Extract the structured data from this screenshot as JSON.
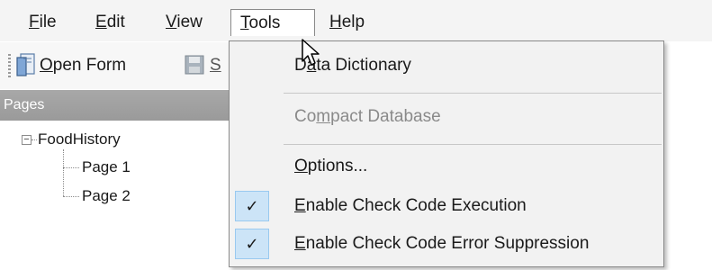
{
  "menubar": {
    "items": [
      {
        "accel": "F",
        "rest": "ile"
      },
      {
        "accel": "E",
        "rest": "dit"
      },
      {
        "accel": "V",
        "rest": "iew"
      },
      {
        "accel": "T",
        "rest": "ools"
      },
      {
        "accel": "H",
        "rest": "elp"
      }
    ]
  },
  "toolbar": {
    "open_form": {
      "accel": "O",
      "rest": "pen Form"
    },
    "save_partial": "S"
  },
  "pages_panel": {
    "title": "Pages",
    "root": "FoodHistory",
    "children": [
      "Page 1",
      "Page 2"
    ]
  },
  "tools_menu": {
    "items": [
      {
        "pre": "D",
        "accel": "a",
        "rest": "ta Dictionary",
        "enabled": true
      },
      {
        "pre": "Co",
        "accel": "m",
        "rest": "pact Database",
        "enabled": false
      },
      {
        "pre": "",
        "accel": "O",
        "rest": "ptions...",
        "enabled": true
      },
      {
        "pre": "",
        "accel": "E",
        "rest": "nable Check Code Execution",
        "enabled": true,
        "checked": true,
        "check_mark": "✓"
      },
      {
        "pre": "",
        "accel": "E",
        "rest": "nable Check Code Error Suppression",
        "enabled": true,
        "checked": true,
        "check_mark": "✓"
      }
    ]
  },
  "icons": {
    "open_form": "open-form-icon",
    "save": "save-icon",
    "cursor": "mouse-pointer-icon"
  }
}
